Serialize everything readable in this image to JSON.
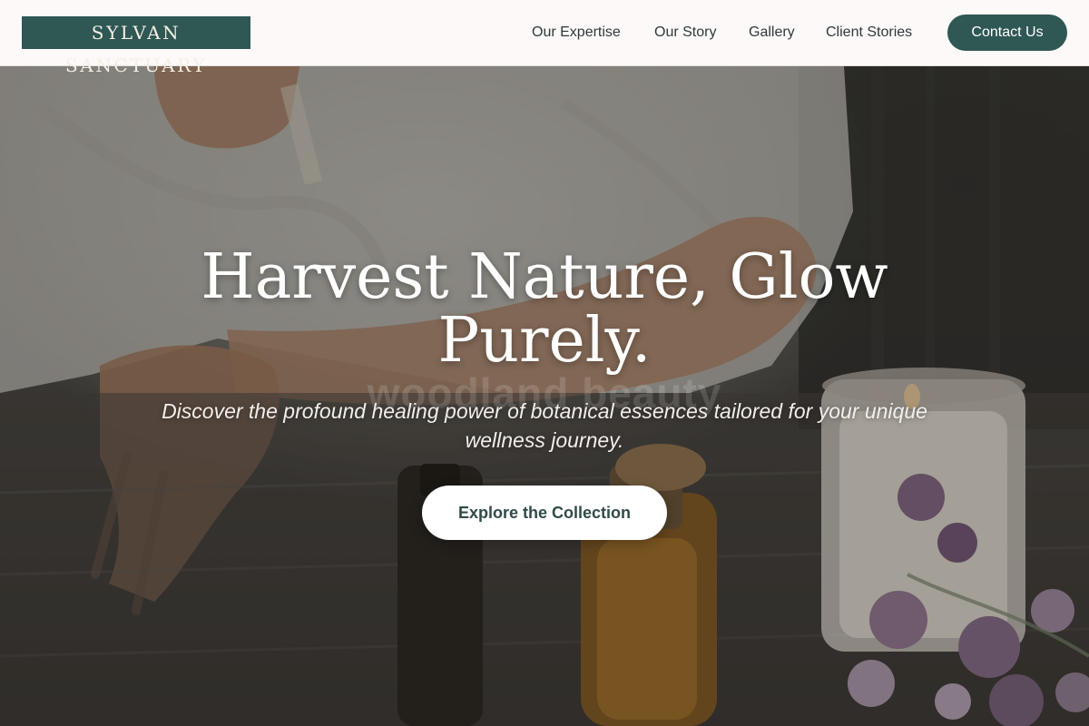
{
  "brand": {
    "name": "SYLVAN SANCTUARY"
  },
  "nav": {
    "items": [
      {
        "label": "Our Expertise"
      },
      {
        "label": "Our Story"
      },
      {
        "label": "Gallery"
      },
      {
        "label": "Client Stories"
      }
    ],
    "contact_label": "Contact Us"
  },
  "hero": {
    "title": "Harvest Nature, Glow Purely.",
    "ghost_text": "woodland beauty",
    "subtitle": "Discover the profound healing power of botanical essences tailored for your unique wellness journey.",
    "cta_label": "Explore the Collection"
  },
  "colors": {
    "brand_green": "#2f5753",
    "header_bg": "#fcf9f8",
    "cta_bg": "#ffffff",
    "cta_text": "#2f4b48"
  }
}
